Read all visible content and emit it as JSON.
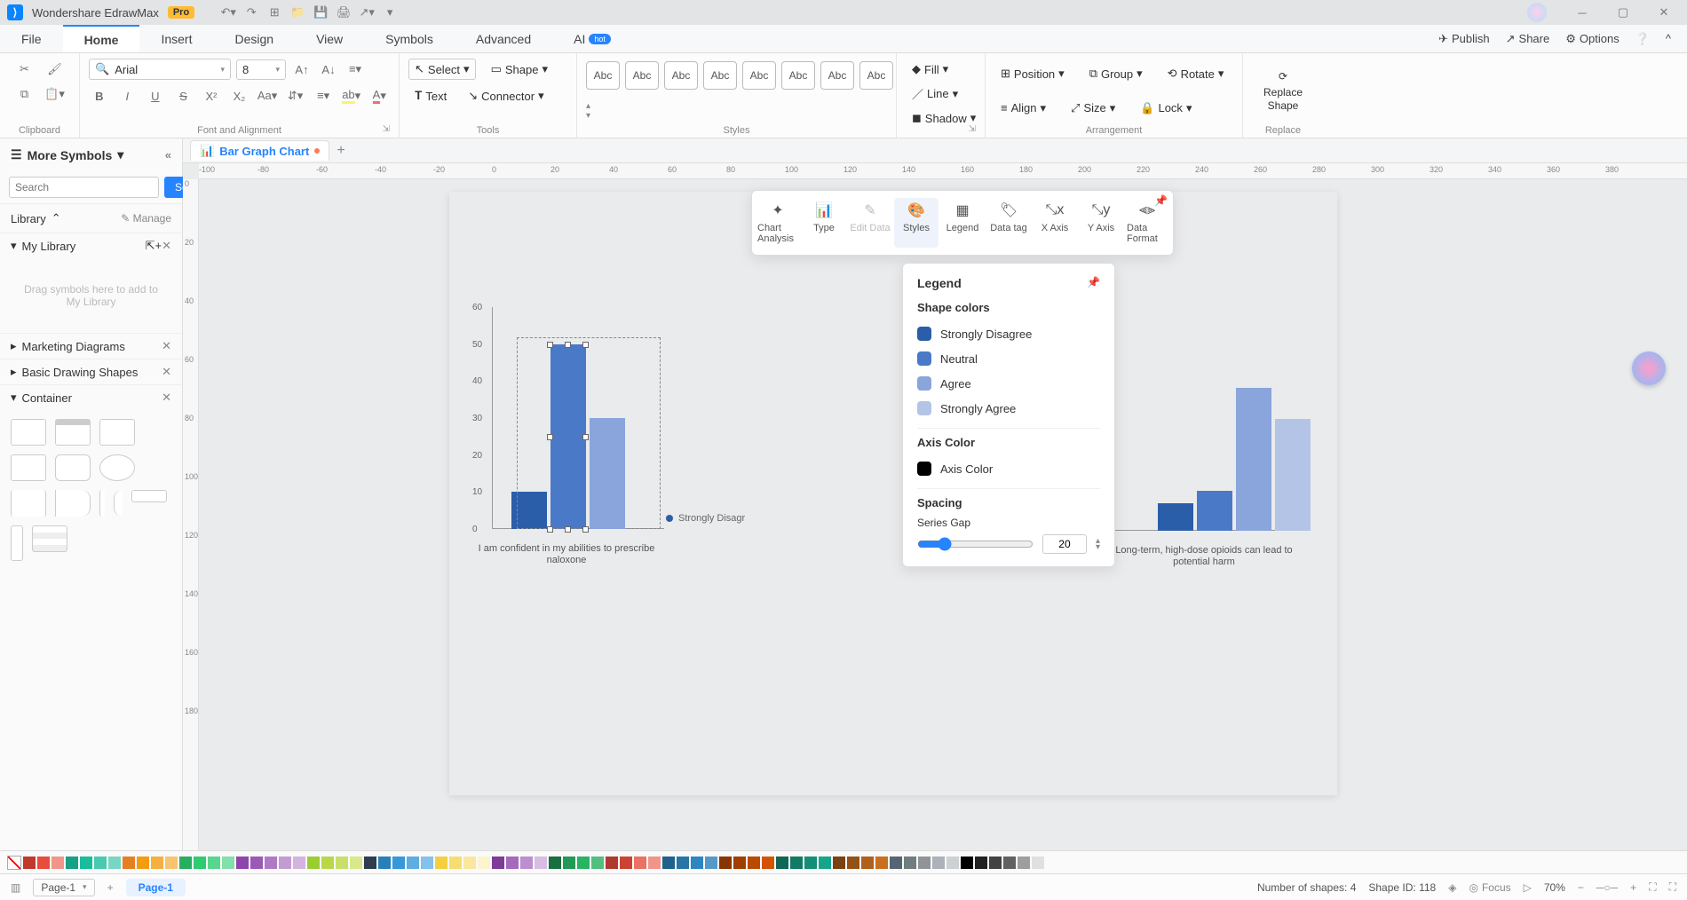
{
  "app": {
    "name": "Wondershare EdrawMax",
    "badge": "Pro"
  },
  "menu": {
    "tabs": [
      "File",
      "Home",
      "Insert",
      "Design",
      "View",
      "Symbols",
      "Advanced",
      "AI"
    ],
    "active": 1,
    "hot_on": 7,
    "right": {
      "publish": "Publish",
      "share": "Share",
      "options": "Options"
    }
  },
  "ribbon": {
    "clipboard": {
      "label": "Clipboard"
    },
    "font": {
      "label": "Font and Alignment",
      "font_name": "Arial",
      "font_size": "8"
    },
    "tools": {
      "label": "Tools",
      "select": "Select",
      "text": "Text",
      "shape": "Shape",
      "connector": "Connector"
    },
    "styles": {
      "label": "Styles",
      "sample": "Abc"
    },
    "fill": {
      "fill": "Fill",
      "line": "Line",
      "shadow": "Shadow"
    },
    "arrangement": {
      "label": "Arrangement",
      "position": "Position",
      "align": "Align",
      "group": "Group",
      "size": "Size",
      "rotate": "Rotate",
      "lock": "Lock"
    },
    "replace": {
      "label": "Replace",
      "replace_shape": "Replace Shape"
    }
  },
  "left": {
    "title": "More Symbols",
    "search_placeholder": "Search",
    "search_btn": "Search",
    "library_label": "Library",
    "manage": "Manage",
    "mylib": "My Library",
    "drop_hint": "Drag symbols here to add to My Library",
    "sections": [
      "Marketing Diagrams",
      "Basic Drawing Shapes",
      "Container"
    ]
  },
  "doc": {
    "tab": "Bar Graph Chart",
    "modified": true
  },
  "ruler_x": [
    "-100",
    "-80",
    "-60",
    "-40",
    "-20",
    "0",
    "20",
    "40",
    "60",
    "80",
    "100",
    "120",
    "140",
    "160",
    "180",
    "200",
    "220",
    "240",
    "260",
    "280",
    "300",
    "320",
    "340",
    "360",
    "380"
  ],
  "ruler_y": [
    "0",
    "20",
    "40",
    "60",
    "80",
    "100",
    "120",
    "140",
    "160",
    "180"
  ],
  "chart_toolbar": {
    "items": [
      "Chart Analysis",
      "Type",
      "Edit Data",
      "Styles",
      "Legend",
      "Data tag",
      "X Axis",
      "Y Axis",
      "Data Format"
    ],
    "selected": 3,
    "disabled": [
      2
    ]
  },
  "legend_panel": {
    "title": "Legend",
    "shape_colors": "Shape colors",
    "series": [
      {
        "name": "Strongly Disagree",
        "color": "#2b5ea8"
      },
      {
        "name": "Neutral",
        "color": "#4a7ac7"
      },
      {
        "name": "Agree",
        "color": "#8aa5db"
      },
      {
        "name": "Strongly Agree",
        "color": "#b4c4e6"
      }
    ],
    "axis_color_label": "Axis Color",
    "axis_color": "#000000",
    "spacing_label": "Spacing",
    "series_gap_label": "Series Gap",
    "series_gap": "20"
  },
  "chart_data": [
    {
      "type": "bar",
      "caption": "I am confident in my abilities to prescribe naloxone",
      "ylim": [
        0,
        60
      ],
      "yticks": [
        0,
        10,
        20,
        30,
        40,
        50,
        60
      ],
      "series": [
        {
          "name": "Strongly Disagree",
          "value": 10,
          "color": "#2b5ea8"
        },
        {
          "name": "Neutral",
          "value": 50,
          "color": "#4a7ac7"
        },
        {
          "name": "Agree",
          "value": 30,
          "color": "#8aa5db"
        }
      ],
      "selected_series_index": 1
    },
    {
      "type": "bar",
      "caption": "Long-term, high-dose opioids can lead to potential harm",
      "ylim": [
        0,
        60
      ],
      "yticks": [
        0,
        10,
        20,
        30,
        40,
        50,
        60
      ],
      "series": [
        {
          "name": "Strongly Disagree",
          "value": 9,
          "color": "#2b5ea8"
        },
        {
          "name": "Neutral",
          "value": 13,
          "color": "#4a7ac7"
        },
        {
          "name": "Agree",
          "value": 46,
          "color": "#8aa5db"
        },
        {
          "name": "Strongly Agree",
          "value": 36,
          "color": "#b4c4e6"
        }
      ]
    }
  ],
  "canvas_legend_visible": "Strongly Disagr",
  "colors": [
    "#c0392b",
    "#e74c3c",
    "#f1948a",
    "#16a085",
    "#1abc9c",
    "#48c9b0",
    "#76d7c4",
    "#e67e22",
    "#f39c12",
    "#f5b041",
    "#f8c471",
    "#27ae60",
    "#2ecc71",
    "#58d68d",
    "#82e0aa",
    "#8e44ad",
    "#9b59b6",
    "#af7ac5",
    "#c39bd3",
    "#d2b4de",
    "#9acd32",
    "#b8d84a",
    "#c8e06a",
    "#d8e88a",
    "#2c3e50",
    "#2980b9",
    "#3498db",
    "#5dade2",
    "#85c1e9",
    "#f4d03f",
    "#f7dc6f",
    "#f9e79f",
    "#fcf3cf",
    "#7d3c98",
    "#a569bd",
    "#bb8fce",
    "#d7bde2",
    "#196f3d",
    "#229954",
    "#28b463",
    "#52be80",
    "#b03a2e",
    "#cb4335",
    "#ec7063",
    "#f1948a",
    "#1f618d",
    "#2874a6",
    "#2e86c1",
    "#5499c7",
    "#873600",
    "#a04000",
    "#ba4a00",
    "#d35400",
    "#0e6655",
    "#117a65",
    "#148f77",
    "#17a589",
    "#784212",
    "#935116",
    "#af601a",
    "#ca6f1e",
    "#566573",
    "#717d7e",
    "#909497",
    "#abb2b9",
    "#ccd1d1",
    "#000000",
    "#212121",
    "#424242",
    "#616161",
    "#9e9e9e",
    "#e0e0e0"
  ],
  "status": {
    "page_selector": "Page-1",
    "page_tab": "Page-1",
    "shapes": "Number of shapes: 4",
    "shape_id": "Shape ID: 118",
    "focus": "Focus",
    "zoom": "70%"
  }
}
